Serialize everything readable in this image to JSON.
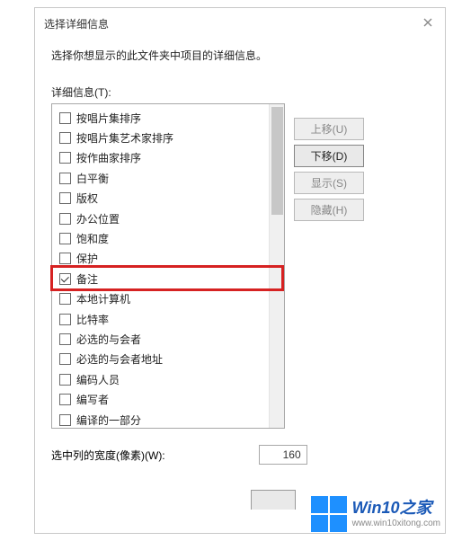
{
  "dialog": {
    "title": "选择详细信息",
    "instruction": "选择你想显示的此文件夹中项目的详细信息。",
    "details_label": "详细信息(T):",
    "items": [
      {
        "label": "按唱片集排序",
        "checked": false
      },
      {
        "label": "按唱片集艺术家排序",
        "checked": false
      },
      {
        "label": "按作曲家排序",
        "checked": false
      },
      {
        "label": "白平衡",
        "checked": false
      },
      {
        "label": "版权",
        "checked": false
      },
      {
        "label": "办公位置",
        "checked": false
      },
      {
        "label": "饱和度",
        "checked": false
      },
      {
        "label": "保护",
        "checked": false
      },
      {
        "label": "备注",
        "checked": true
      },
      {
        "label": "本地计算机",
        "checked": false
      },
      {
        "label": "比特率",
        "checked": false
      },
      {
        "label": "必选的与会者",
        "checked": false
      },
      {
        "label": "必选的与会者地址",
        "checked": false
      },
      {
        "label": "编码人员",
        "checked": false
      },
      {
        "label": "编写者",
        "checked": false
      },
      {
        "label": "编译的一部分",
        "checked": false
      }
    ],
    "buttons": {
      "move_up": "上移(U)",
      "move_down": "下移(D)",
      "show": "显示(S)",
      "hide": "隐藏(H)"
    },
    "width_label": "选中列的宽度(像素)(W):",
    "width_value": "160"
  },
  "watermark": {
    "title": "Win10之家",
    "url": "www.win10xitong.com"
  }
}
